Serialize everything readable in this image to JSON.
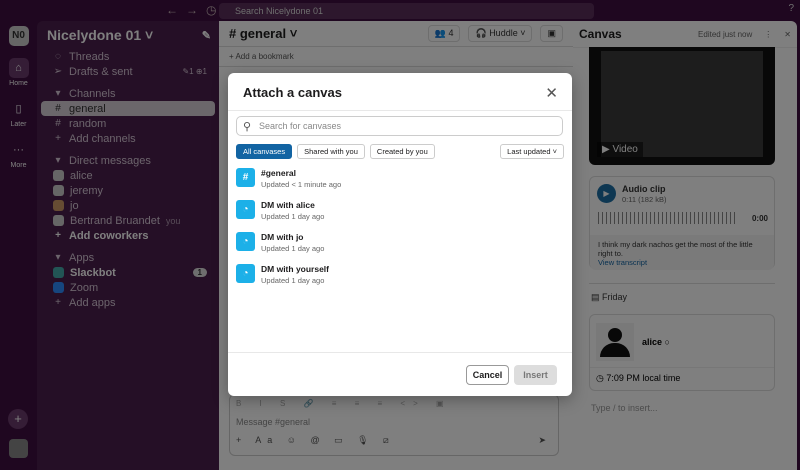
{
  "topbar": {
    "search_placeholder": "Search Nicelydone 01",
    "back": "←",
    "forward": "→",
    "history": "◷",
    "help": "?"
  },
  "rail": {
    "workspace_initials": "N0",
    "items": [
      {
        "label": "Home",
        "icon": "⌂"
      },
      {
        "label": "Later",
        "icon": "▯"
      },
      {
        "label": "More",
        "icon": "···"
      }
    ],
    "add": "+"
  },
  "sidebar": {
    "workspace": "Nicelydone 01 ˅",
    "threads": "Threads",
    "drafts": "Drafts & sent",
    "drafts_counts": "✎1  ⊕1",
    "channels_header": "Channels",
    "channels": [
      {
        "name": "general"
      },
      {
        "name": "random"
      }
    ],
    "add_channels": "Add channels",
    "dm_header": "Direct messages",
    "dms": [
      {
        "name": "alice"
      },
      {
        "name": "jeremy"
      },
      {
        "name": "jo"
      },
      {
        "name": "Bertrand Bruandet",
        "suffix": "you"
      }
    ],
    "add_coworkers": "Add coworkers",
    "apps_header": "Apps",
    "apps": [
      {
        "name": "Slackbot",
        "badge": "1"
      },
      {
        "name": "Zoom"
      }
    ],
    "add_apps": "Add apps"
  },
  "channel": {
    "title": "# general ˅",
    "member_count": "4",
    "huddle": "Huddle",
    "add_bookmark": "+ Add a bookmark",
    "message_placeholder": "Message #general",
    "format_toolbar": "B I S 🔗 ≡ ≡ ≡ <> ▣",
    "actions": "+ Aa ☺ @ ▭ 🎙 ⧄"
  },
  "canvas": {
    "title": "Canvas",
    "edited": "Edited just now",
    "video_label": "▶ Video",
    "audio_title": "Audio clip",
    "audio_meta": "0:11 (182 kB)",
    "audio_time": "0:00",
    "transcript": "I think my dark nachos get the most of the little right to.",
    "view_transcript": "View transcript",
    "friday": "Friday",
    "person": "alice",
    "local_time": "7:09 PM local time",
    "type_hint": "Type  /  to insert..."
  },
  "modal": {
    "title": "Attach a canvas",
    "search_placeholder": "Search for canvases",
    "filters": [
      "All canvases",
      "Shared with you",
      "Created by you"
    ],
    "sort": "Last updated ˅",
    "items": [
      {
        "name": "#general",
        "updated": "Updated < 1 minute ago",
        "icon": "#"
      },
      {
        "name": "DM with alice",
        "updated": "Updated 1 day ago",
        "icon": "◔"
      },
      {
        "name": "DM with jo",
        "updated": "Updated 1 day ago",
        "icon": "◔"
      },
      {
        "name": "DM with yourself",
        "updated": "Updated 1 day ago",
        "icon": "◔"
      }
    ],
    "cancel": "Cancel",
    "insert": "Insert"
  }
}
